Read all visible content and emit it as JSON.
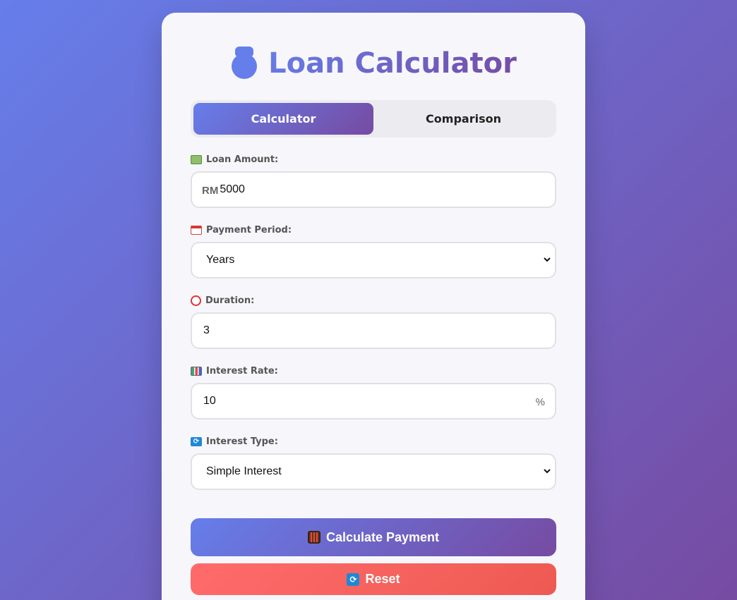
{
  "header": {
    "icon": "money-bag-icon",
    "title": "Loan Calculator"
  },
  "tabs": [
    {
      "label": "Calculator",
      "active": true
    },
    {
      "label": "Comparison",
      "active": false
    }
  ],
  "form": {
    "loan_amount": {
      "icon": "banknote-icon",
      "label": "Loan Amount:",
      "prefix": "RM",
      "value": "5000"
    },
    "payment_period": {
      "icon": "calendar-icon",
      "label": "Payment Period:",
      "value": "Years"
    },
    "duration": {
      "icon": "alarm-clock-icon",
      "label": "Duration:",
      "value": "3"
    },
    "interest_rate": {
      "icon": "bar-chart-icon",
      "label": "Interest Rate:",
      "value": "10",
      "suffix": "%"
    },
    "interest_type": {
      "icon": "cycle-arrows-icon",
      "label": "Interest Type:",
      "value": "Simple Interest"
    }
  },
  "buttons": {
    "calculate": {
      "icon": "abacus-icon",
      "label": "Calculate Payment"
    },
    "reset": {
      "icon": "cycle-arrows-icon",
      "label": "Reset"
    }
  },
  "colors": {
    "accent_start": "#667eea",
    "accent_end": "#764ba2",
    "reset_start": "#ff6b6b",
    "reset_end": "#ee5a52"
  }
}
